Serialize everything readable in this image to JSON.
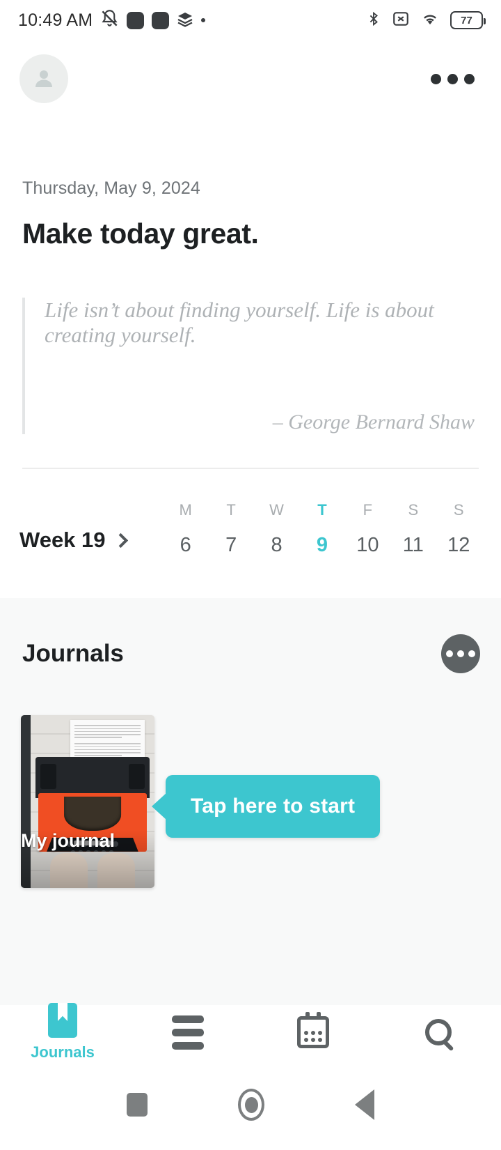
{
  "status_bar": {
    "time": "10:49 AM",
    "battery_level": "77",
    "icons": [
      "bell-muted-icon",
      "app-square-icon",
      "app-square-icon",
      "layers-icon",
      "dot-icon",
      "bluetooth-icon",
      "sim-off-icon",
      "wifi-icon",
      "battery-icon"
    ]
  },
  "header": {
    "avatar": "person-avatar-icon",
    "overflow": "more-options-icon"
  },
  "greeting": {
    "date": "Thursday, May 9, 2024",
    "headline": "Make today great."
  },
  "quote": {
    "text": "Life isn’t about finding yourself. Life is about creating yourself.",
    "author": "– George Bernard Shaw"
  },
  "week": {
    "label": "Week 19",
    "chevron": "chevron-right-icon",
    "days": [
      {
        "dow": "M",
        "num": "6",
        "today": false
      },
      {
        "dow": "T",
        "num": "7",
        "today": false
      },
      {
        "dow": "W",
        "num": "8",
        "today": false
      },
      {
        "dow": "T",
        "num": "9",
        "today": true
      },
      {
        "dow": "F",
        "num": "10",
        "today": false
      },
      {
        "dow": "S",
        "num": "11",
        "today": false
      },
      {
        "dow": "S",
        "num": "12",
        "today": false
      }
    ]
  },
  "journals": {
    "title": "Journals",
    "options": "more-options-icon",
    "card_label": "My journal",
    "tooltip": "Tap here to start"
  },
  "bottom_nav": [
    {
      "name": "journals",
      "label": "Journals",
      "icon": "book-bookmark-icon",
      "active": true
    },
    {
      "name": "entries",
      "label": "",
      "icon": "list-icon",
      "active": false
    },
    {
      "name": "calendar",
      "label": "",
      "icon": "calendar-icon",
      "active": false
    },
    {
      "name": "search",
      "label": "",
      "icon": "search-icon",
      "active": false
    }
  ],
  "system_nav": [
    "recents-square-icon",
    "home-circle-icon",
    "back-triangle-icon"
  ],
  "colors": {
    "accent": "#3dc6cf",
    "text_dark": "#1d2022",
    "text_muted": "#6f7478",
    "quote_gray": "#aeb2b5",
    "panel_bg": "#f8f9f9"
  }
}
